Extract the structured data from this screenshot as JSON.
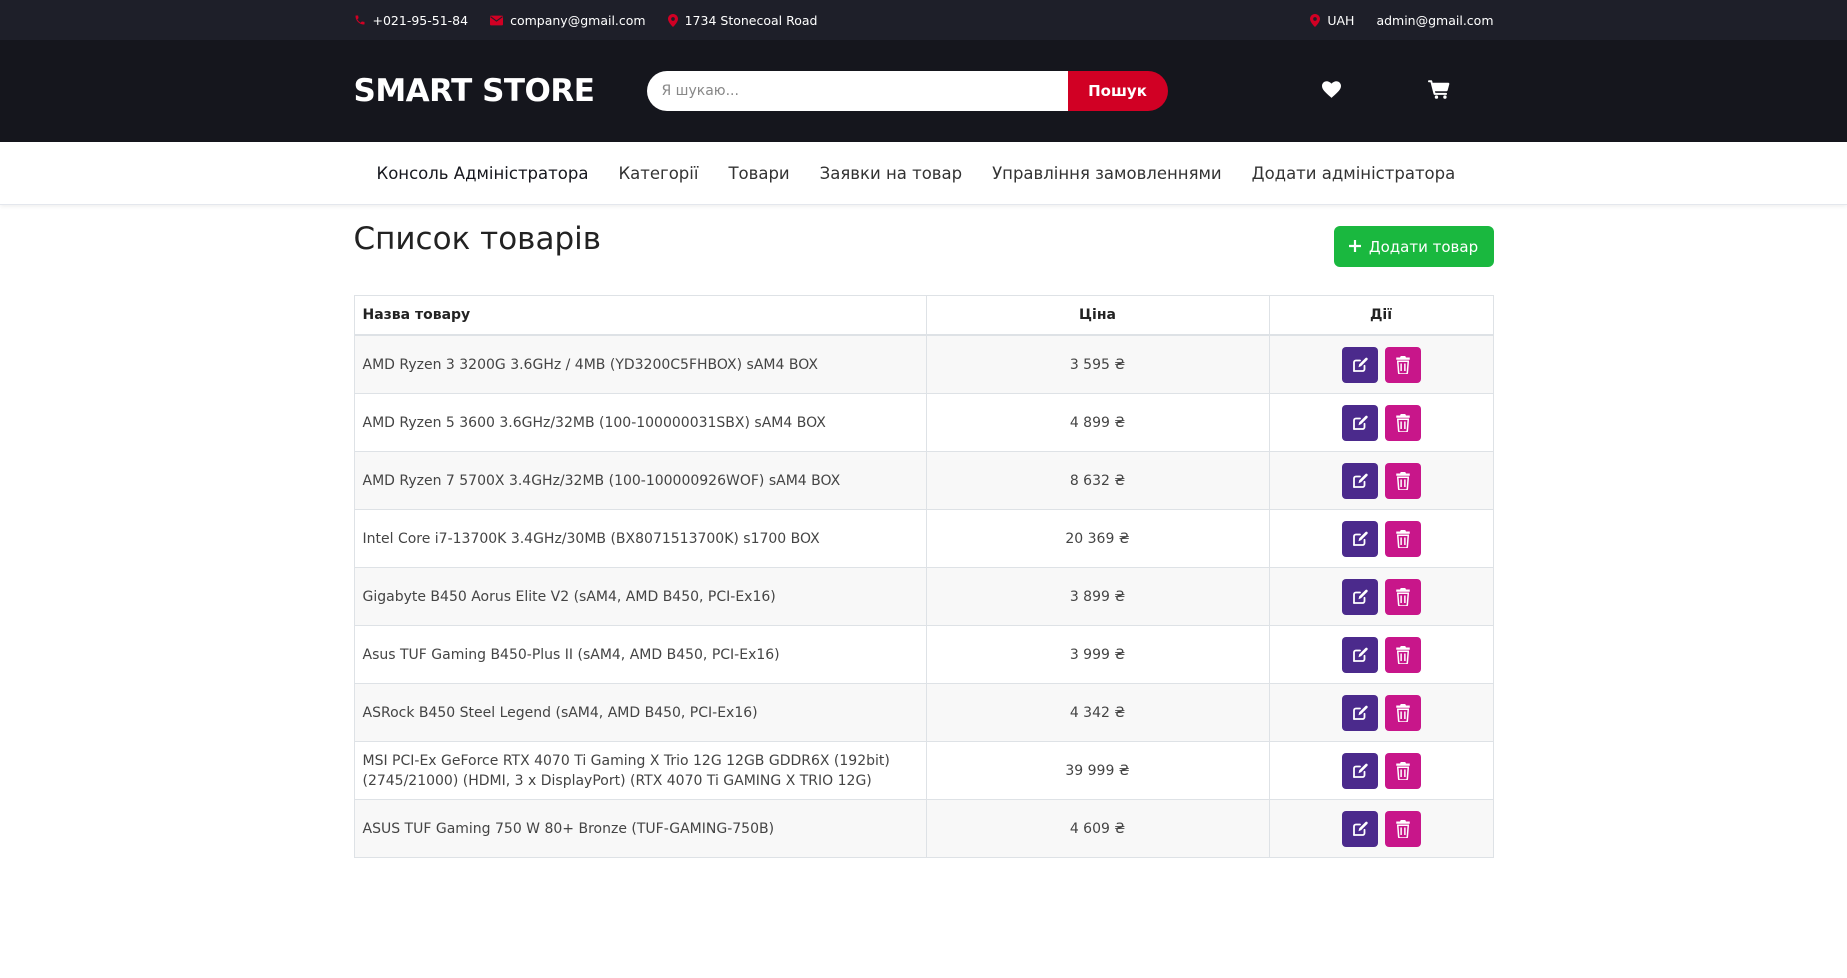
{
  "topbar": {
    "phone": "+021-95-51-84",
    "email": "company@gmail.com",
    "address": "1734 Stonecoal Road",
    "currency": "UAH",
    "user": "admin@gmail.com"
  },
  "header": {
    "logo": "SMART STORE",
    "search_placeholder": "Я шукаю...",
    "search_button": "Пошук",
    "icons": [
      "heart-icon",
      "cart-icon"
    ]
  },
  "nav": {
    "items": [
      {
        "label": "Консоль Адміністратора"
      },
      {
        "label": "Категорії"
      },
      {
        "label": "Товари"
      },
      {
        "label": "Заявки на товар"
      },
      {
        "label": "Управління замовленнями"
      },
      {
        "label": "Додати адміністратора"
      }
    ]
  },
  "main": {
    "title": "Список товарів",
    "add_button": "Додати товар",
    "columns": {
      "name": "Назва товару",
      "price": "Ціна",
      "actions": "Дії"
    },
    "products": [
      {
        "name": "AMD Ryzen 3 3200G 3.6GHz / 4MB (YD3200C5FHBOX) sAM4 BOX",
        "price": "3 595 ₴"
      },
      {
        "name": "AMD Ryzen 5 3600 3.6GHz/32MB (100-100000031SBX) sAM4 BOX",
        "price": "4 899 ₴"
      },
      {
        "name": "AMD Ryzen 7 5700X 3.4GHz/32MB (100-100000926WOF) sAM4 BOX",
        "price": "8 632 ₴"
      },
      {
        "name": "Intel Core i7-13700K 3.4GHz/30MB (BX8071513700K) s1700 BOX",
        "price": "20 369 ₴"
      },
      {
        "name": "Gigabyte B450 Aorus Elite V2 (sAM4, AMD B450, PCI-Ex16)",
        "price": "3 899 ₴"
      },
      {
        "name": "Asus TUF Gaming B450-Plus II (sAM4, AMD B450, PCI-Ex16)",
        "price": "3 999 ₴"
      },
      {
        "name": "ASRock B450 Steel Legend (sAM4, AMD B450, PCI-Ex16)",
        "price": "4 342 ₴"
      },
      {
        "name": "MSI PCI-Ex GeForce RTX 4070 Ti Gaming X Trio 12G 12GB GDDR6X (192bit) (2745/21000) (HDMI, 3 x DisplayPort) (RTX 4070 Ti GAMING X TRIO 12G)",
        "price": "39 999 ₴"
      },
      {
        "name": "ASUS TUF Gaming 750 W 80+ Bronze (TUF-GAMING-750B)",
        "price": "4 609 ₴"
      }
    ]
  },
  "colors": {
    "accent": "#d10024",
    "topbar_bg": "#1e1f29",
    "header_bg": "#15161d",
    "add_button": "#1ab83f",
    "edit_button": "#4b2a8c",
    "delete_button": "#c8168a"
  }
}
